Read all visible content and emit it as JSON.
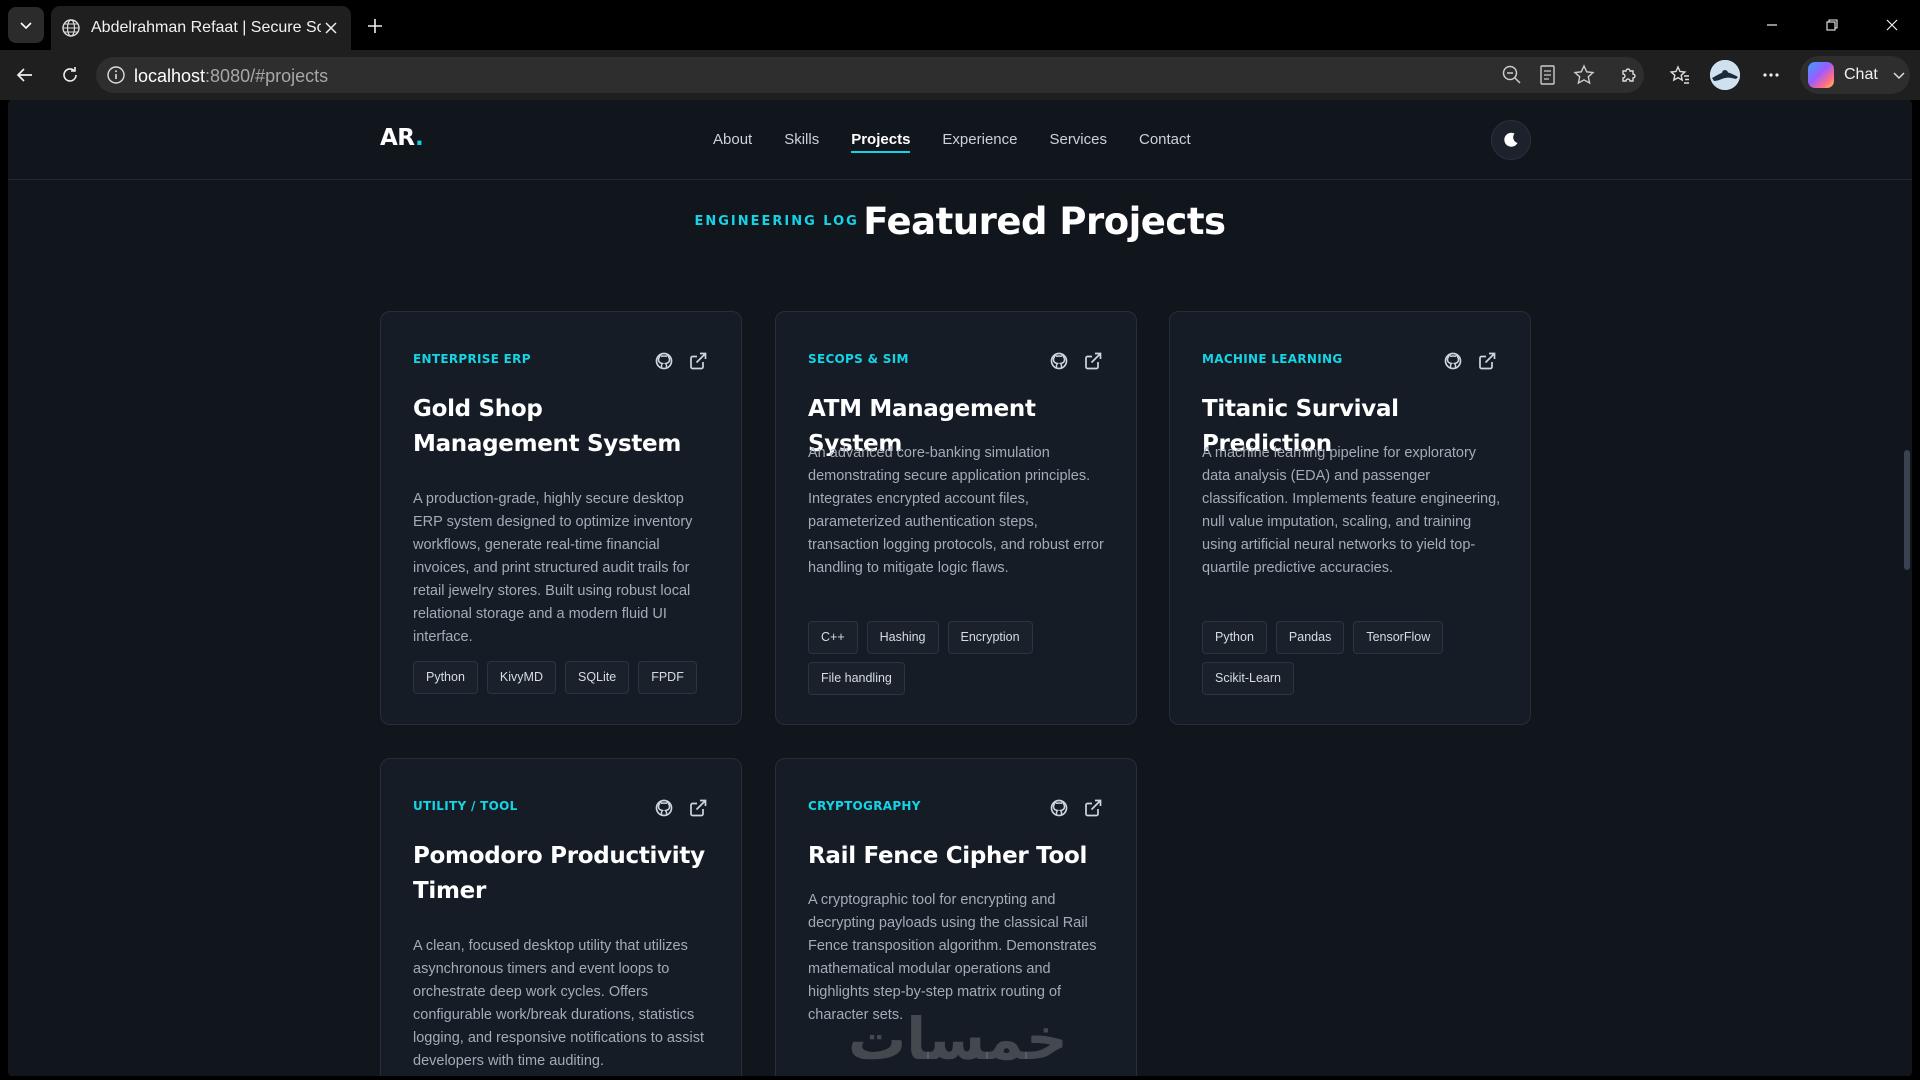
{
  "browser": {
    "tab_title": "Abdelrahman Refaat | Secure Software Engineer",
    "url_host": "localhost",
    "url_rest": ":8080/#projects",
    "chat_label": "Chat"
  },
  "nav": {
    "brand": "AR",
    "brand_dot": ".",
    "links": [
      "About",
      "Skills",
      "Projects",
      "Experience",
      "Services",
      "Contact"
    ],
    "active": "Projects"
  },
  "section": {
    "eyebrow": "Engineering Log",
    "title": "Featured Projects"
  },
  "projects": [
    {
      "category": "Enterprise ERP",
      "title": "Gold Shop Management System",
      "description": "A production-grade, highly secure desktop ERP system designed to optimize inventory workflows, generate real-time financial invoices, and print structured audit trails for retail jewelry stores. Built using robust local relational storage and a modern fluid UI interface.",
      "tags": [
        "Python",
        "KivyMD",
        "SQLite",
        "FPDF"
      ]
    },
    {
      "category": "SecOps & Sim",
      "title": "ATM Management System",
      "description": "An advanced core-banking simulation demonstrating secure application principles. Integrates encrypted account files, parameterized authentication steps, transaction logging protocols, and robust error handling to mitigate logic flaws.",
      "tags": [
        "C++",
        "Hashing",
        "Encryption",
        "File handling"
      ]
    },
    {
      "category": "Machine Learning",
      "title": "Titanic Survival Prediction",
      "description": "A machine learning pipeline for exploratory data analysis (EDA) and passenger classification. Implements feature engineering, null value imputation, scaling, and training using artificial neural networks to yield top-quartile predictive accuracies.",
      "tags": [
        "Python",
        "Pandas",
        "TensorFlow",
        "Scikit-Learn"
      ]
    },
    {
      "category": "Utility / Tool",
      "title": "Pomodoro Productivity Timer",
      "description": "A clean, focused desktop utility that utilizes asynchronous timers and event loops to orchestrate deep work cycles. Offers configurable work/break durations, statistics logging, and responsive notifications to assist developers with time auditing.",
      "tags": []
    },
    {
      "category": "Cryptography",
      "title": "Rail Fence Cipher Tool",
      "description": "A cryptographic tool for encrypting and decrypting payloads using the classical Rail Fence transposition algorithm. Demonstrates mathematical modular operations and highlights step-by-step matrix routing of character sets.",
      "tags": []
    }
  ],
  "watermark": "خمسات",
  "colors": {
    "accent": "#14d4e6",
    "page_bg": "#11151c",
    "card_bg": "#161c25"
  }
}
